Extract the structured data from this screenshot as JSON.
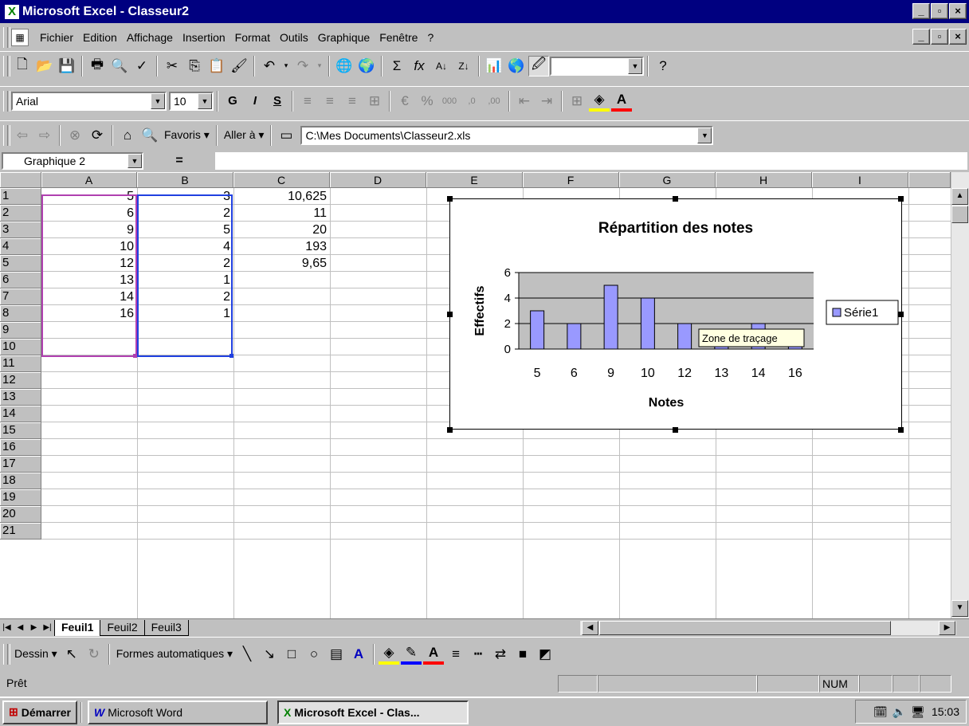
{
  "window": {
    "title": "Microsoft Excel - Classeur2",
    "min": "_",
    "max": "ð",
    "close": "×"
  },
  "menu": {
    "items": [
      "Fichier",
      "Edition",
      "Affichage",
      "Insertion",
      "Format",
      "Outils",
      "Graphique",
      "Fenêtre",
      "?"
    ]
  },
  "toolbar_format": {
    "font": "Arial",
    "size": "10",
    "bold": "G",
    "italic": "I",
    "underline": "S"
  },
  "toolbar_web": {
    "favoris": "Favoris ▾",
    "aller": "Aller à ▾",
    "address": "C:\\Mes Documents\\Classeur2.xls"
  },
  "formula": {
    "namebox": "Graphique 2",
    "eq": "="
  },
  "columns": [
    "A",
    "B",
    "C",
    "D",
    "E",
    "F",
    "G",
    "H",
    "I"
  ],
  "rows": [
    "1",
    "2",
    "3",
    "4",
    "5",
    "6",
    "7",
    "8",
    "9",
    "10",
    "11",
    "12",
    "13",
    "14",
    "15",
    "16",
    "17",
    "18",
    "19",
    "20",
    "21"
  ],
  "cells": {
    "A": [
      "5",
      "6",
      "9",
      "10",
      "12",
      "13",
      "14",
      "16"
    ],
    "B": [
      "3",
      "2",
      "5",
      "4",
      "2",
      "1",
      "2",
      "1"
    ],
    "C": [
      "10,625",
      "11",
      "20",
      "193",
      "9,65"
    ]
  },
  "chart_data": {
    "type": "bar",
    "title": "Répartition des notes",
    "xlabel": "Notes",
    "ylabel": "Effectifs",
    "categories": [
      "5",
      "6",
      "9",
      "10",
      "12",
      "13",
      "14",
      "16"
    ],
    "series": [
      {
        "name": "Série1",
        "values": [
          3,
          2,
          5,
          4,
          2,
          1,
          2,
          1
        ]
      }
    ],
    "ylim": [
      0,
      6
    ],
    "yticks": [
      "0",
      "2",
      "4",
      "6"
    ],
    "legend": "right",
    "grid": true,
    "bar_color": "#9999ff",
    "plot_bg": "#c0c0c0",
    "tooltip": "Zone de traçage"
  },
  "sheets": {
    "tabs": [
      "Feuil1",
      "Feuil2",
      "Feuil3"
    ],
    "active": "Feuil1"
  },
  "drawbar": {
    "dessin": "Dessin ▾",
    "formes": "Formes automatiques ▾"
  },
  "status": {
    "ready": "Prêt",
    "num": "NUM"
  },
  "taskbar": {
    "start": "Démarrer",
    "word": "Microsoft Word",
    "excel": "Microsoft Excel - Clas...",
    "clock": "15:03"
  }
}
